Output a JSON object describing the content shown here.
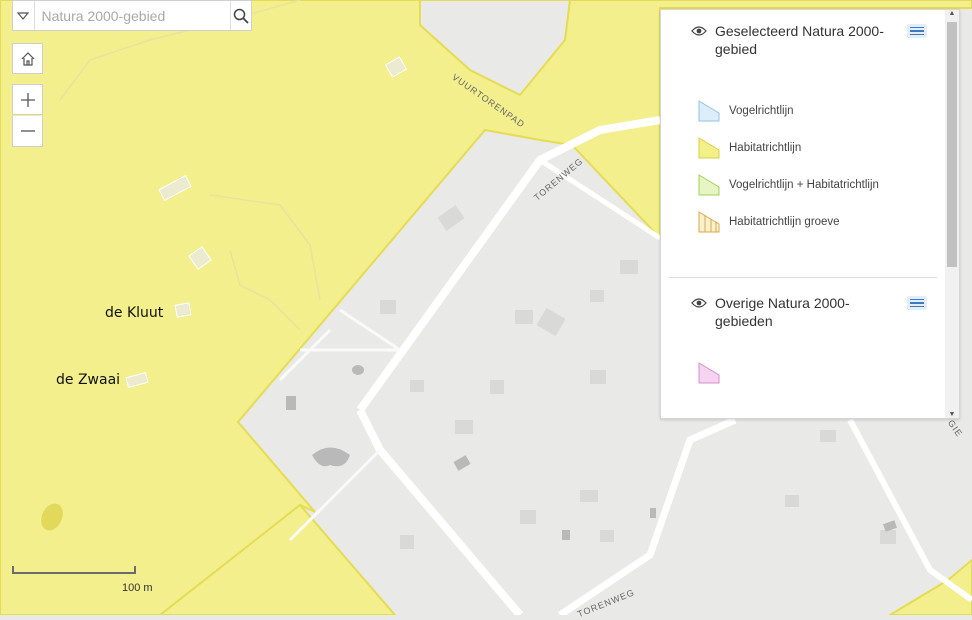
{
  "search": {
    "placeholder": "Natura 2000-gebied"
  },
  "map_controls": {
    "home_icon": "home-icon",
    "zoom_in": "+",
    "zoom_out": "—"
  },
  "places": [
    "de Kluut",
    "de Zwaai"
  ],
  "roads": [
    "VUURTORENPAD",
    "TORENWEG",
    "TORENWEG",
    "GIE"
  ],
  "scale": {
    "label": "100 m"
  },
  "legend": {
    "sections": [
      {
        "title": "Geselecteerd Natura 2000-gebied",
        "items": [
          {
            "label": "Vogelrichtlijn",
            "color": "#ddeefa"
          },
          {
            "label": "Habitatrichtlijn",
            "color": "#f3f08a"
          },
          {
            "label": "Vogelrichtlijn + Habitatrichtlijn",
            "color": "#e8f5c2"
          },
          {
            "label": "Habitatrichtlijn groeve",
            "color": "#f7f1cf"
          }
        ]
      },
      {
        "title": "Overige Natura 2000-gebieden",
        "items": [
          {
            "label": "",
            "color": "#f6d3f0"
          }
        ]
      }
    ]
  },
  "colors": {
    "natura": "#f2ef8c",
    "natura_border": "#e4dc54",
    "base": "#e9eae8",
    "road": "#ffffff"
  }
}
